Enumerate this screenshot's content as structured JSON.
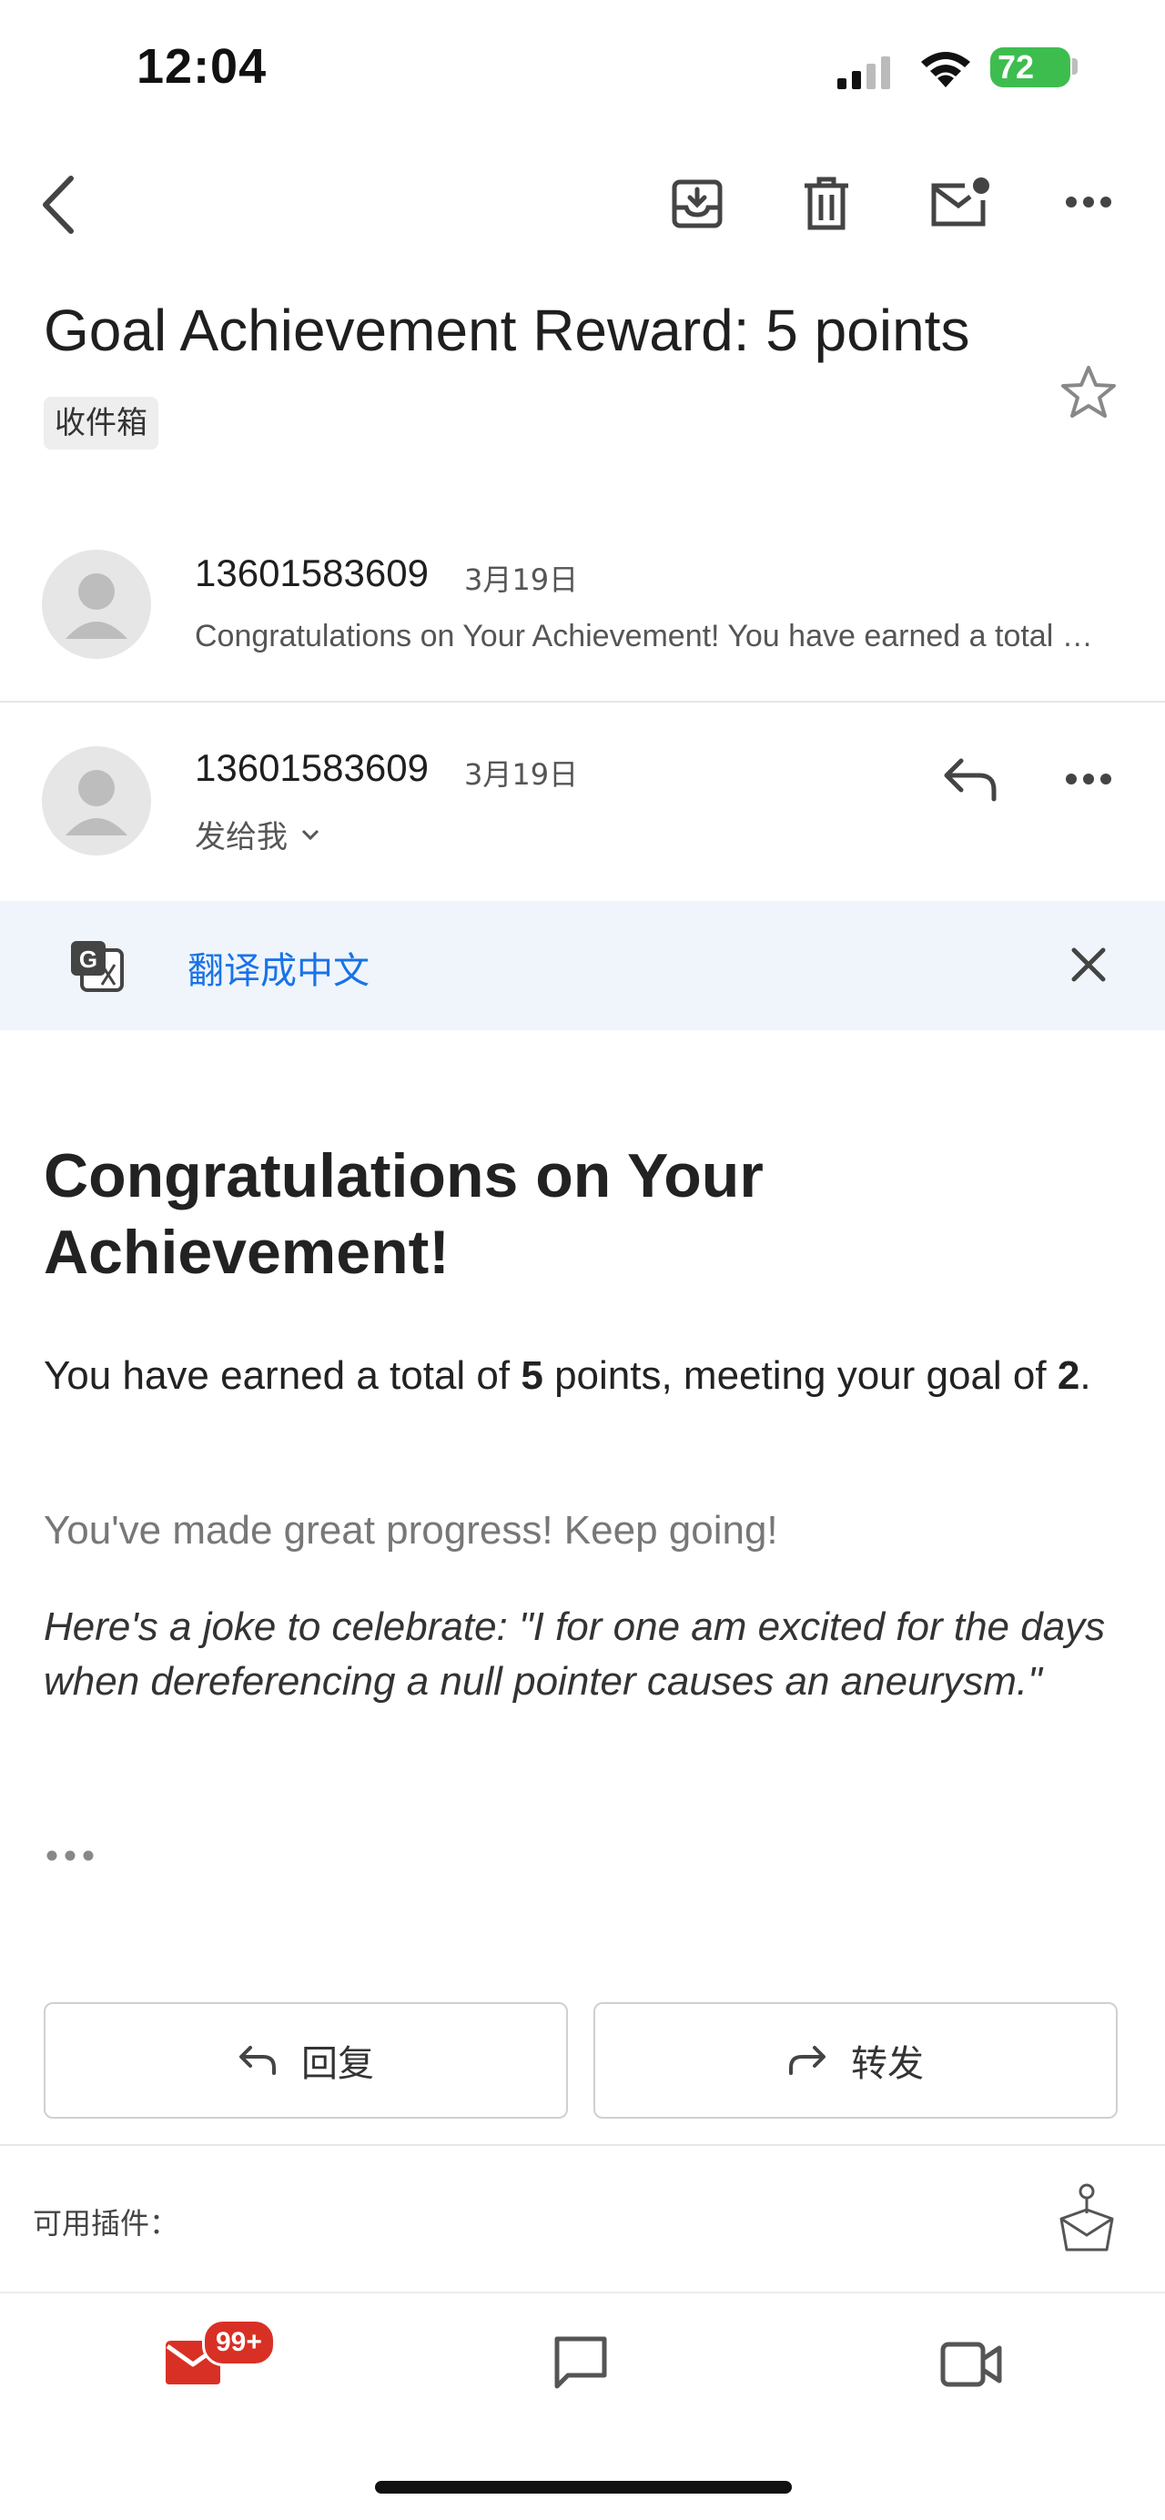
{
  "status_bar": {
    "time": "12:04",
    "battery": "72"
  },
  "email": {
    "subject": "Goal Achievement Reward: 5 points",
    "label": "收件箱",
    "messages": [
      {
        "sender": "13601583609",
        "date": "3月19日",
        "snippet": "Congratulations on Your Achievement! You have earned a total of 5 points, meeting your goal of 2."
      },
      {
        "sender": "13601583609",
        "date": "3月19日",
        "recipient": "发给我"
      }
    ]
  },
  "translate": {
    "label": "翻译成中文"
  },
  "body": {
    "heading": "Congratulations on Your Achievement!",
    "p1": {
      "before_points": "You have earned a total of ",
      "points": "5",
      "middle": " points, meeting your goal of ",
      "goal": "2",
      "end": "."
    },
    "p2": "You've made great progress! Keep going!",
    "p3": "Here's a joke to celebrate: \"I for one am excited for the days when dereferencing a null pointer causes an aneurysm.\""
  },
  "actions": {
    "reply": "回复",
    "forward": "转发"
  },
  "plugins_label": "可用插件：",
  "nav": {
    "mail_badge": "99+"
  },
  "colors": {
    "accent": "#1a73e8",
    "mail_red": "#d93025",
    "battery_green": "#3ebd4f"
  }
}
